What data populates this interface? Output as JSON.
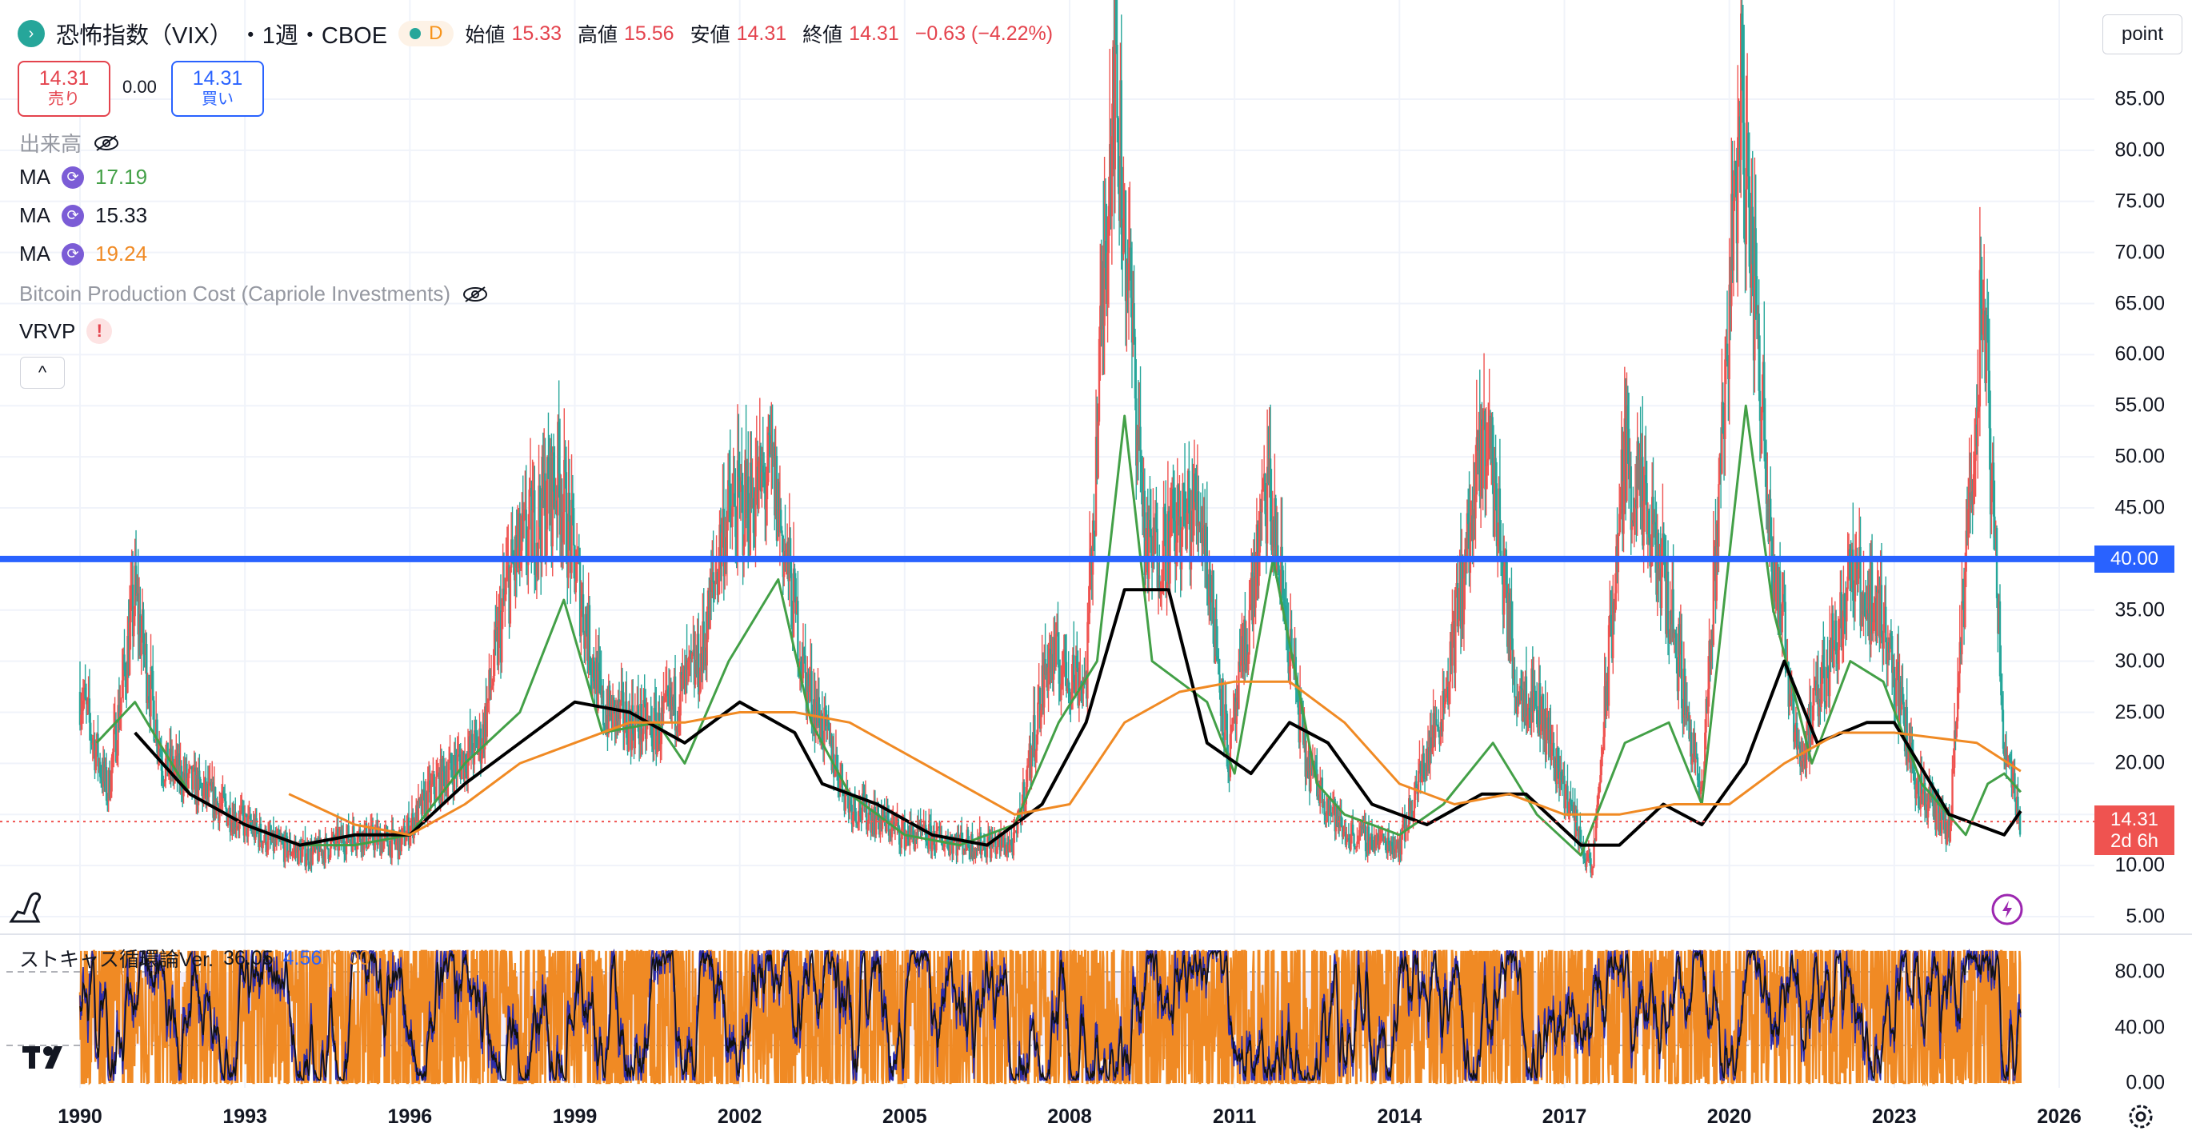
{
  "header": {
    "symbol": "恐怖指数（VIX）",
    "interval": "・1週・CBOE",
    "feed_badge": "D",
    "open_label": "始値",
    "open": "15.33",
    "high_label": "高値",
    "high": "15.56",
    "low_label": "安値",
    "low": "14.31",
    "close_label": "終値",
    "close": "14.31",
    "change": "−0.63 (−4.22%)"
  },
  "quote": {
    "sell_price": "14.31",
    "sell_label": "売り",
    "spread": "0.00",
    "buy_price": "14.31",
    "buy_label": "買い"
  },
  "indicators": {
    "volume": "出来高",
    "ma1_label": "MA",
    "ma1_value": "17.19",
    "ma2_label": "MA",
    "ma2_value": "15.33",
    "ma3_label": "MA",
    "ma3_value": "19.24",
    "btc": "Bitcoin Production Cost (Capriole Investments)",
    "vrvp": "VRVP",
    "vrvp_warning": "!"
  },
  "toolbar": {
    "scale_button": "point",
    "collapse_icon": "^"
  },
  "price_axis": {
    "ticks": [
      "85.00",
      "80.00",
      "75.00",
      "70.00",
      "65.00",
      "60.00",
      "55.00",
      "50.00",
      "45.00",
      "40.00",
      "35.00",
      "30.00",
      "25.00",
      "20.00",
      "15.00",
      "10.00",
      "5.00"
    ]
  },
  "price_tags": {
    "level": "40.00",
    "last": "14.31",
    "countdown": "2d 6h"
  },
  "time_axis": {
    "ticks": [
      "1990",
      "1993",
      "1996",
      "1999",
      "2002",
      "2005",
      "2008",
      "2011",
      "2014",
      "2017",
      "2020",
      "2023",
      "2026"
    ]
  },
  "oscillator": {
    "name": "ストキャス循環論Ver.",
    "v1": "36.05",
    "v2": "4.56",
    "v3": "0.00",
    "ticks": [
      "80.00",
      "40.00",
      "0.00"
    ]
  },
  "colors": {
    "up": "#26a69a",
    "down": "#ef5350",
    "ma1": "#43a047",
    "ma2": "#000000",
    "ma3": "#f08a24",
    "level_line": "#2962ff",
    "osc_orange": "#f08a24",
    "osc_blue": "#2a2aa8"
  },
  "chart_data": [
    {
      "type": "candlestick",
      "symbol": "VIX",
      "interval": "1W",
      "ylim": [
        5,
        90
      ],
      "x_range": [
        1990,
        2026
      ],
      "last_close": 14.31,
      "horizontal_level": 40,
      "key_points": [
        {
          "x": 1990.0,
          "y": 27
        },
        {
          "x": 1990.5,
          "y": 17
        },
        {
          "x": 1991.0,
          "y": 36
        },
        {
          "x": 1991.5,
          "y": 20
        },
        {
          "x": 1992.5,
          "y": 16
        },
        {
          "x": 1993.5,
          "y": 12
        },
        {
          "x": 1994.2,
          "y": 11
        },
        {
          "x": 1995.0,
          "y": 13
        },
        {
          "x": 1995.8,
          "y": 12
        },
        {
          "x": 1996.5,
          "y": 18
        },
        {
          "x": 1997.3,
          "y": 22
        },
        {
          "x": 1997.8,
          "y": 38
        },
        {
          "x": 1998.7,
          "y": 48
        },
        {
          "x": 1999.5,
          "y": 25
        },
        {
          "x": 2000.5,
          "y": 23
        },
        {
          "x": 2001.3,
          "y": 30
        },
        {
          "x": 2001.7,
          "y": 43
        },
        {
          "x": 2002.6,
          "y": 48
        },
        {
          "x": 2003.2,
          "y": 28
        },
        {
          "x": 2004.0,
          "y": 16
        },
        {
          "x": 2005.0,
          "y": 13
        },
        {
          "x": 2006.3,
          "y": 12
        },
        {
          "x": 2007.0,
          "y": 12
        },
        {
          "x": 2007.6,
          "y": 30
        },
        {
          "x": 2008.3,
          "y": 28
        },
        {
          "x": 2008.8,
          "y": 89
        },
        {
          "x": 2009.4,
          "y": 40
        },
        {
          "x": 2010.4,
          "y": 45
        },
        {
          "x": 2010.9,
          "y": 20
        },
        {
          "x": 2011.6,
          "y": 47
        },
        {
          "x": 2012.3,
          "y": 20
        },
        {
          "x": 2013.0,
          "y": 13
        },
        {
          "x": 2014.0,
          "y": 12
        },
        {
          "x": 2014.8,
          "y": 26
        },
        {
          "x": 2015.6,
          "y": 53
        },
        {
          "x": 2016.1,
          "y": 28
        },
        {
          "x": 2016.5,
          "y": 26
        },
        {
          "x": 2017.5,
          "y": 9
        },
        {
          "x": 2018.1,
          "y": 50
        },
        {
          "x": 2018.9,
          "y": 36
        },
        {
          "x": 2019.5,
          "y": 16
        },
        {
          "x": 2020.2,
          "y": 85
        },
        {
          "x": 2020.8,
          "y": 40
        },
        {
          "x": 2021.3,
          "y": 20
        },
        {
          "x": 2022.2,
          "y": 38
        },
        {
          "x": 2022.8,
          "y": 34
        },
        {
          "x": 2023.4,
          "y": 18
        },
        {
          "x": 2024.0,
          "y": 13
        },
        {
          "x": 2024.6,
          "y": 65
        },
        {
          "x": 2025.0,
          "y": 22
        },
        {
          "x": 2025.3,
          "y": 14.31
        }
      ],
      "series": [
        {
          "name": "MA",
          "value": 17.19,
          "points": [
            [
              1990.3,
              22
            ],
            [
              1991.0,
              26
            ],
            [
              1992.0,
              17
            ],
            [
              1993.0,
              14
            ],
            [
              1994.0,
              12
            ],
            [
              1995.0,
              12
            ],
            [
              1996.0,
              13
            ],
            [
              1997.0,
              20
            ],
            [
              1998.0,
              25
            ],
            [
              1998.8,
              36
            ],
            [
              1999.5,
              23
            ],
            [
              2000.5,
              24
            ],
            [
              2001.0,
              20
            ],
            [
              2001.8,
              30
            ],
            [
              2002.7,
              38
            ],
            [
              2003.3,
              24
            ],
            [
              2004.0,
              17
            ],
            [
              2005.0,
              13
            ],
            [
              2006.0,
              12
            ],
            [
              2007.0,
              14
            ],
            [
              2007.8,
              24
            ],
            [
              2008.5,
              30
            ],
            [
              2009.0,
              54
            ],
            [
              2009.5,
              30
            ],
            [
              2010.5,
              26
            ],
            [
              2011.0,
              19
            ],
            [
              2011.7,
              40
            ],
            [
              2012.5,
              18
            ],
            [
              2013.0,
              15
            ],
            [
              2014.0,
              13
            ],
            [
              2014.8,
              16
            ],
            [
              2015.7,
              22
            ],
            [
              2016.5,
              15
            ],
            [
              2017.3,
              11
            ],
            [
              2018.1,
              22
            ],
            [
              2018.9,
              24
            ],
            [
              2019.5,
              16
            ],
            [
              2020.3,
              55
            ],
            [
              2020.8,
              35
            ],
            [
              2021.5,
              20
            ],
            [
              2022.2,
              30
            ],
            [
              2022.8,
              28
            ],
            [
              2023.5,
              18
            ],
            [
              2024.3,
              13
            ],
            [
              2024.7,
              18
            ],
            [
              2025.0,
              19
            ],
            [
              2025.3,
              17.19
            ]
          ]
        },
        {
          "name": "MA",
          "value": 15.33,
          "points": [
            [
              1991.0,
              23
            ],
            [
              1992.0,
              17
            ],
            [
              1993.0,
              14
            ],
            [
              1994.0,
              12
            ],
            [
              1995.0,
              13
            ],
            [
              1996.0,
              13
            ],
            [
              1997.0,
              18
            ],
            [
              1998.0,
              22
            ],
            [
              1999.0,
              26
            ],
            [
              2000.0,
              25
            ],
            [
              2001.0,
              22
            ],
            [
              2002.0,
              26
            ],
            [
              2003.0,
              23
            ],
            [
              2003.5,
              18
            ],
            [
              2004.5,
              16
            ],
            [
              2005.5,
              13
            ],
            [
              2006.5,
              12
            ],
            [
              2007.5,
              16
            ],
            [
              2008.3,
              24
            ],
            [
              2009.0,
              37
            ],
            [
              2009.8,
              37
            ],
            [
              2010.5,
              22
            ],
            [
              2011.3,
              19
            ],
            [
              2012.0,
              24
            ],
            [
              2012.7,
              22
            ],
            [
              2013.5,
              16
            ],
            [
              2014.5,
              14
            ],
            [
              2015.5,
              17
            ],
            [
              2016.3,
              17
            ],
            [
              2017.3,
              12
            ],
            [
              2018.0,
              12
            ],
            [
              2018.8,
              16
            ],
            [
              2019.5,
              14
            ],
            [
              2020.3,
              20
            ],
            [
              2021.0,
              30
            ],
            [
              2021.6,
              22
            ],
            [
              2022.5,
              24
            ],
            [
              2023.0,
              24
            ],
            [
              2024.0,
              15
            ],
            [
              2025.0,
              13
            ],
            [
              2025.3,
              15.33
            ]
          ]
        },
        {
          "name": "MA",
          "value": 19.24,
          "points": [
            [
              1993.8,
              17
            ],
            [
              1995.0,
              14
            ],
            [
              1996.0,
              13
            ],
            [
              1997.0,
              16
            ],
            [
              1998.0,
              20
            ],
            [
              1999.0,
              22
            ],
            [
              2000.0,
              24
            ],
            [
              2001.0,
              24
            ],
            [
              2002.0,
              25
            ],
            [
              2003.0,
              25
            ],
            [
              2004.0,
              24
            ],
            [
              2005.0,
              21
            ],
            [
              2006.0,
              18
            ],
            [
              2007.0,
              15
            ],
            [
              2008.0,
              16
            ],
            [
              2009.0,
              24
            ],
            [
              2010.0,
              27
            ],
            [
              2011.0,
              28
            ],
            [
              2012.0,
              28
            ],
            [
              2013.0,
              24
            ],
            [
              2014.0,
              18
            ],
            [
              2015.0,
              16
            ],
            [
              2016.0,
              17
            ],
            [
              2017.0,
              15
            ],
            [
              2018.0,
              15
            ],
            [
              2019.0,
              16
            ],
            [
              2020.0,
              16
            ],
            [
              2021.0,
              20
            ],
            [
              2022.0,
              23
            ],
            [
              2023.0,
              23
            ],
            [
              2024.5,
              22
            ],
            [
              2025.3,
              19.24
            ]
          ]
        }
      ]
    },
    {
      "type": "line",
      "title": "ストキャス循環論Ver.",
      "ylim": [
        0,
        100
      ],
      "series": [
        {
          "name": "36.05",
          "value": 36.05
        },
        {
          "name": "4.56",
          "value": 4.56
        },
        {
          "name": "0.00",
          "value": 0.0
        }
      ]
    }
  ]
}
